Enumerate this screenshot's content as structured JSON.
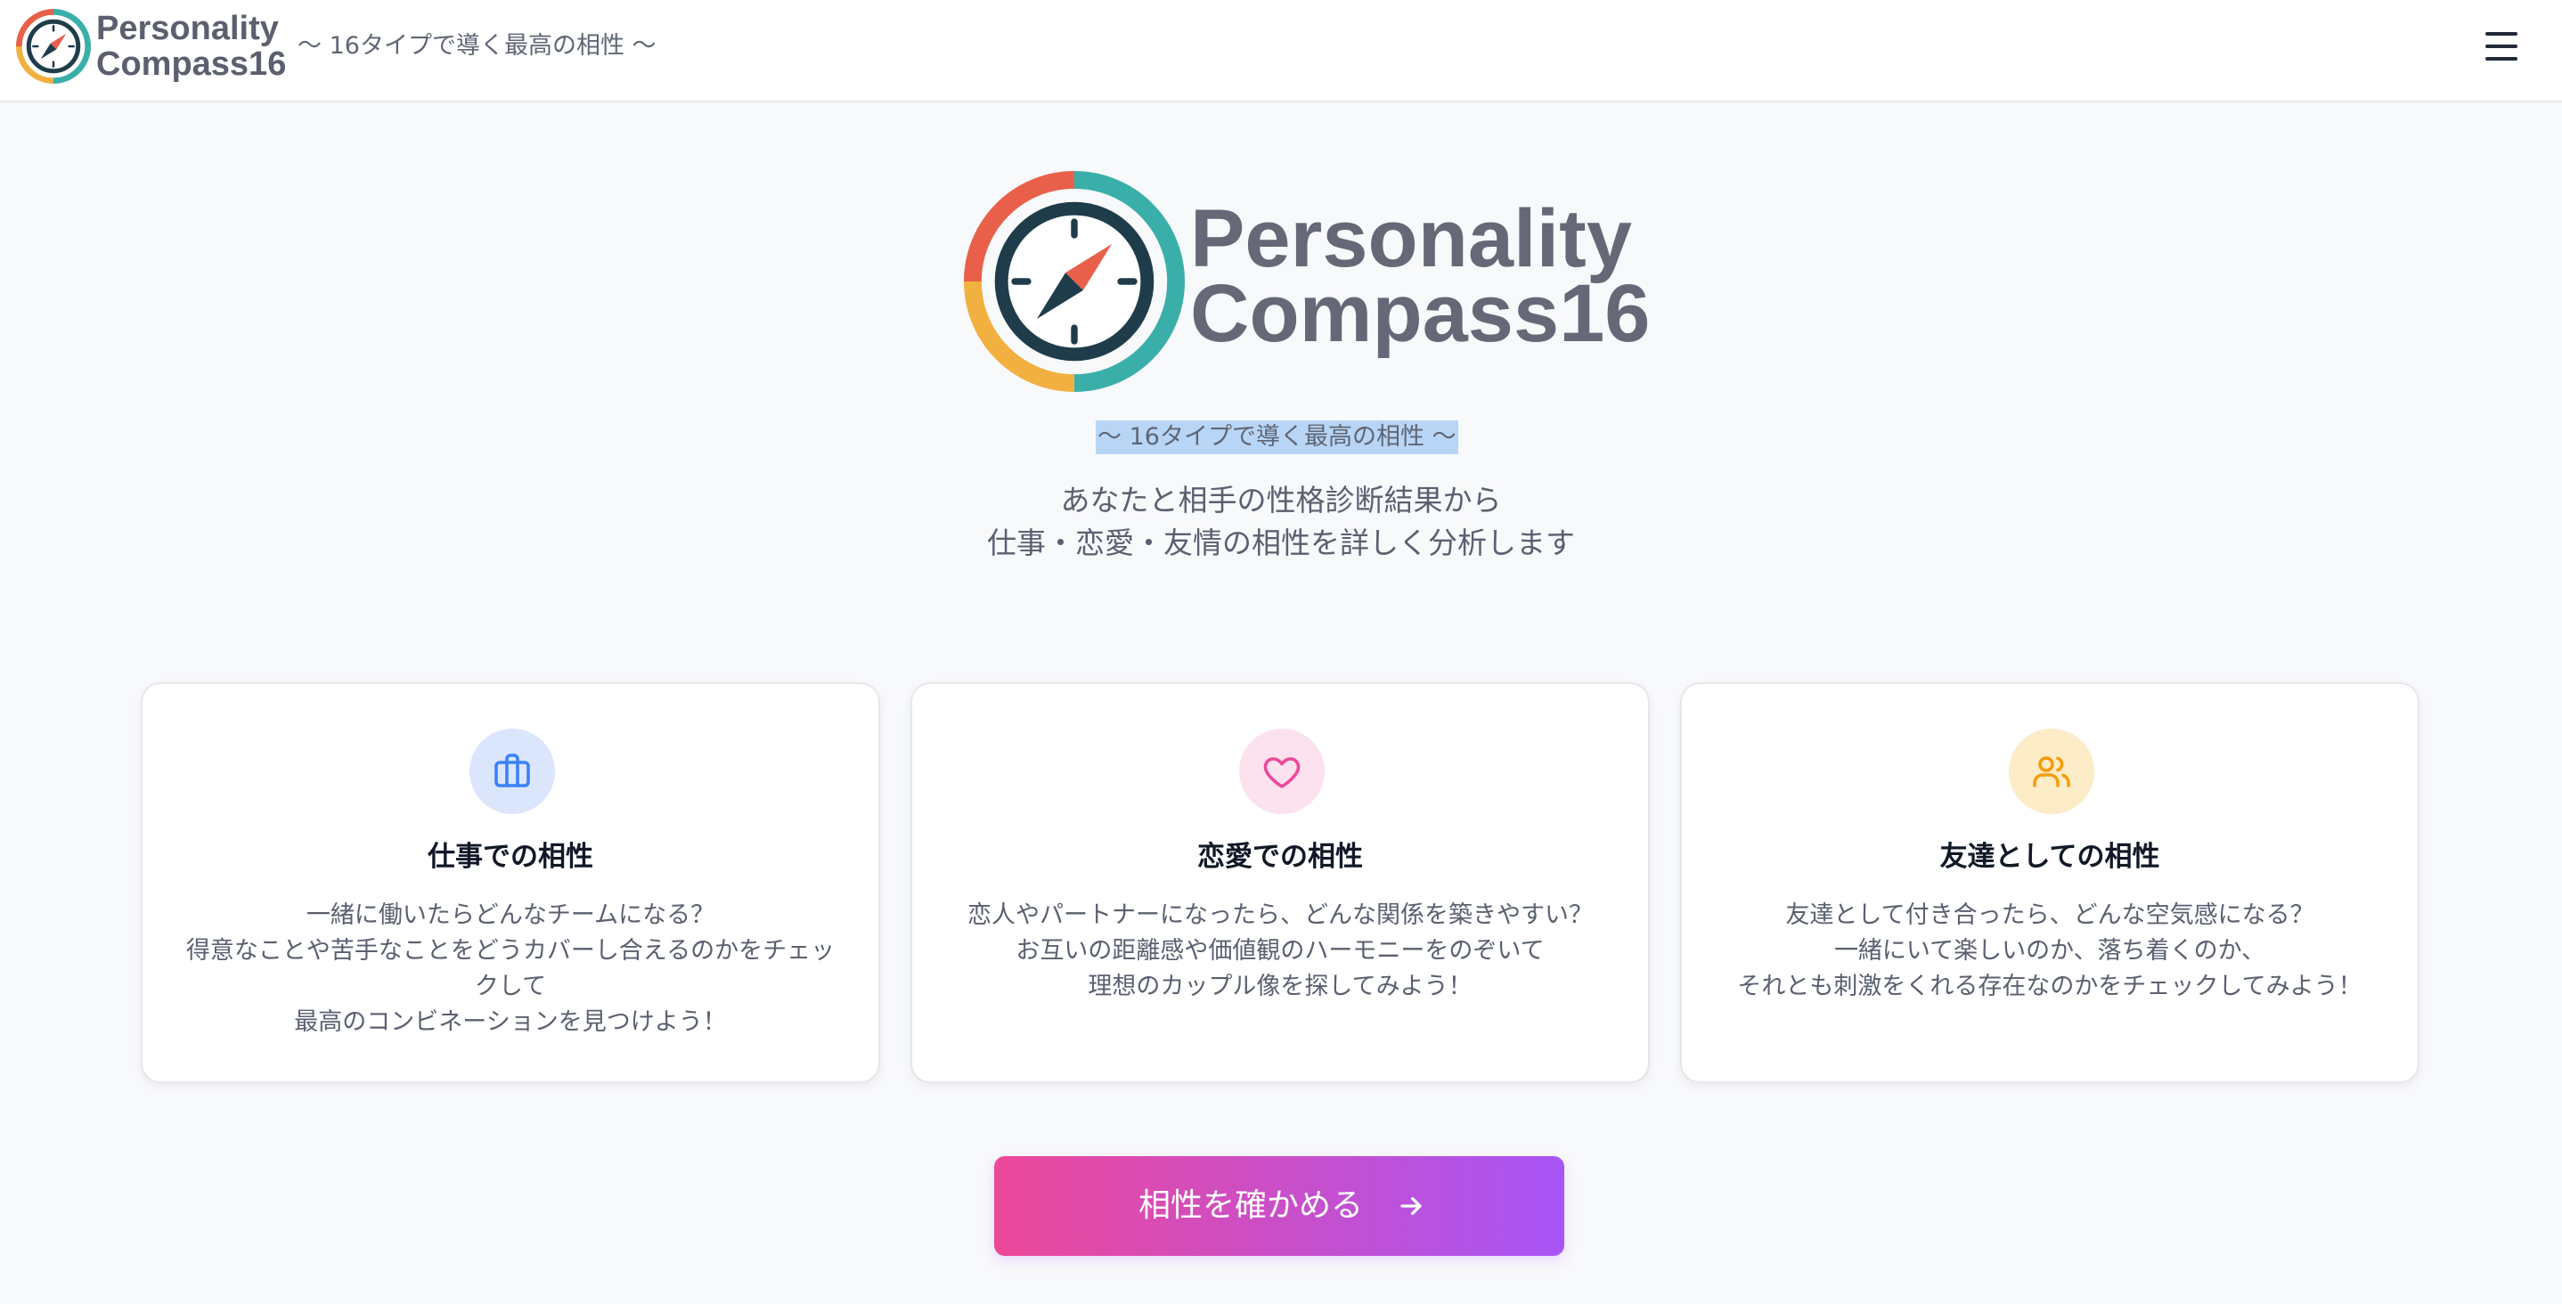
{
  "header": {
    "brand_line1": "Personality",
    "brand_line2": "Compass16",
    "tagline": "〜 16タイプで導く最高の相性 〜",
    "menu_icon": "hamburger-menu-icon"
  },
  "hero": {
    "brand_line1": "Personality",
    "brand_line2": "Compass16",
    "tagline": "〜 16タイプで導く最高の相性 〜",
    "desc_line1": "あなたと相手の性格診断結果から",
    "desc_line2": "仕事・恋愛・友情の相性を詳しく分析します",
    "logo_icon": "compass-logo-icon"
  },
  "cards": [
    {
      "icon": "briefcase-icon",
      "title": "仕事での相性",
      "lines": [
        "一緒に働いたらどんなチームになる？",
        "得意なことや苦手なことをどうカバーし合えるのかをチェッ",
        "クして",
        "最高のコンビネーションを見つけよう！"
      ]
    },
    {
      "icon": "heart-icon",
      "title": "恋愛での相性",
      "lines": [
        "恋人やパートナーになったら、どんな関係を築きやすい？",
        "お互いの距離感や価値観のハーモニーをのぞいて",
        "理想のカップル像を探してみよう！"
      ]
    },
    {
      "icon": "users-icon",
      "title": "友達としての相性",
      "lines": [
        "友達として付き合ったら、どんな空気感になる？",
        "一緒にいて楽しいのか、落ち着くのか、",
        "それとも刺激をくれる存在なのかをチェックしてみよう！"
      ]
    }
  ],
  "cta": {
    "label": "相性を確かめる",
    "icon": "arrow-right-icon"
  },
  "colors": {
    "compass_red": "#e8604a",
    "compass_teal": "#3aafa9",
    "compass_yellow": "#f2b040",
    "compass_navy": "#1f3c4a",
    "cta_start": "#ec4899",
    "cta_end": "#a855f7",
    "work_bg": "#dbe6fd",
    "work_icon": "#3b82f6",
    "love_bg": "#fce1ee",
    "love_icon": "#ec4899",
    "friend_bg": "#fdecc8",
    "friend_icon": "#f59e0b"
  }
}
